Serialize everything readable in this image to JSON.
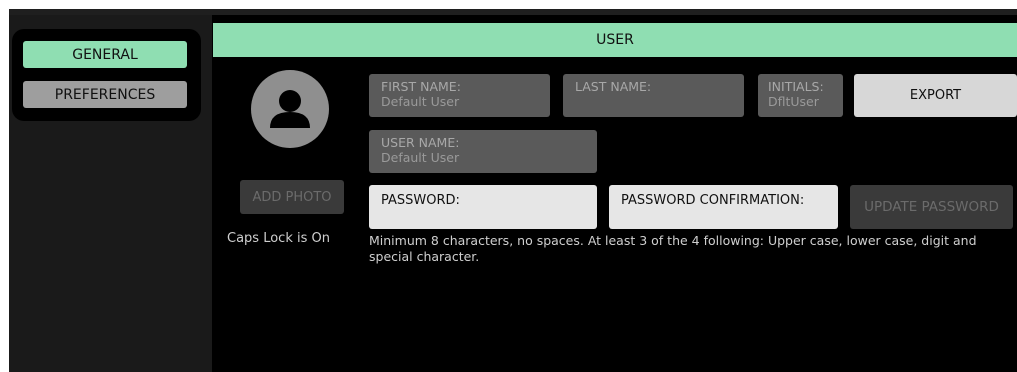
{
  "tabs": [
    {
      "label": "GENERAL",
      "active": true
    },
    {
      "label": "PREFERENCES",
      "active": false
    }
  ],
  "header": {
    "title": "USER"
  },
  "photo": {
    "add_label": "ADD PHOTO",
    "icon": "user-icon"
  },
  "caps_lock": "Caps Lock is On",
  "fields": {
    "first_name": {
      "label": "FIRST NAME:",
      "value": "Default User"
    },
    "last_name": {
      "label": "LAST NAME:",
      "value": ""
    },
    "initials": {
      "label": "INITIALS:",
      "value": "DfltUser"
    },
    "user_name": {
      "label": "USER NAME:",
      "value": "Default User"
    },
    "password": {
      "label": "PASSWORD:",
      "value": ""
    },
    "password_confirmation": {
      "label": "PASSWORD CONFIRMATION:",
      "value": ""
    }
  },
  "buttons": {
    "export": "EXPORT",
    "update_password": "UPDATE PASSWORD"
  },
  "password_hint": "Minimum 8 characters, no spaces. At least 3 of the 4 following: Upper case, lower case, digit and special character.",
  "colors": {
    "accent": "#8fdeb2",
    "tab_inactive": "#9e9e9e",
    "field_dark": "#5a5a5a",
    "field_light": "#e6e6e6"
  }
}
